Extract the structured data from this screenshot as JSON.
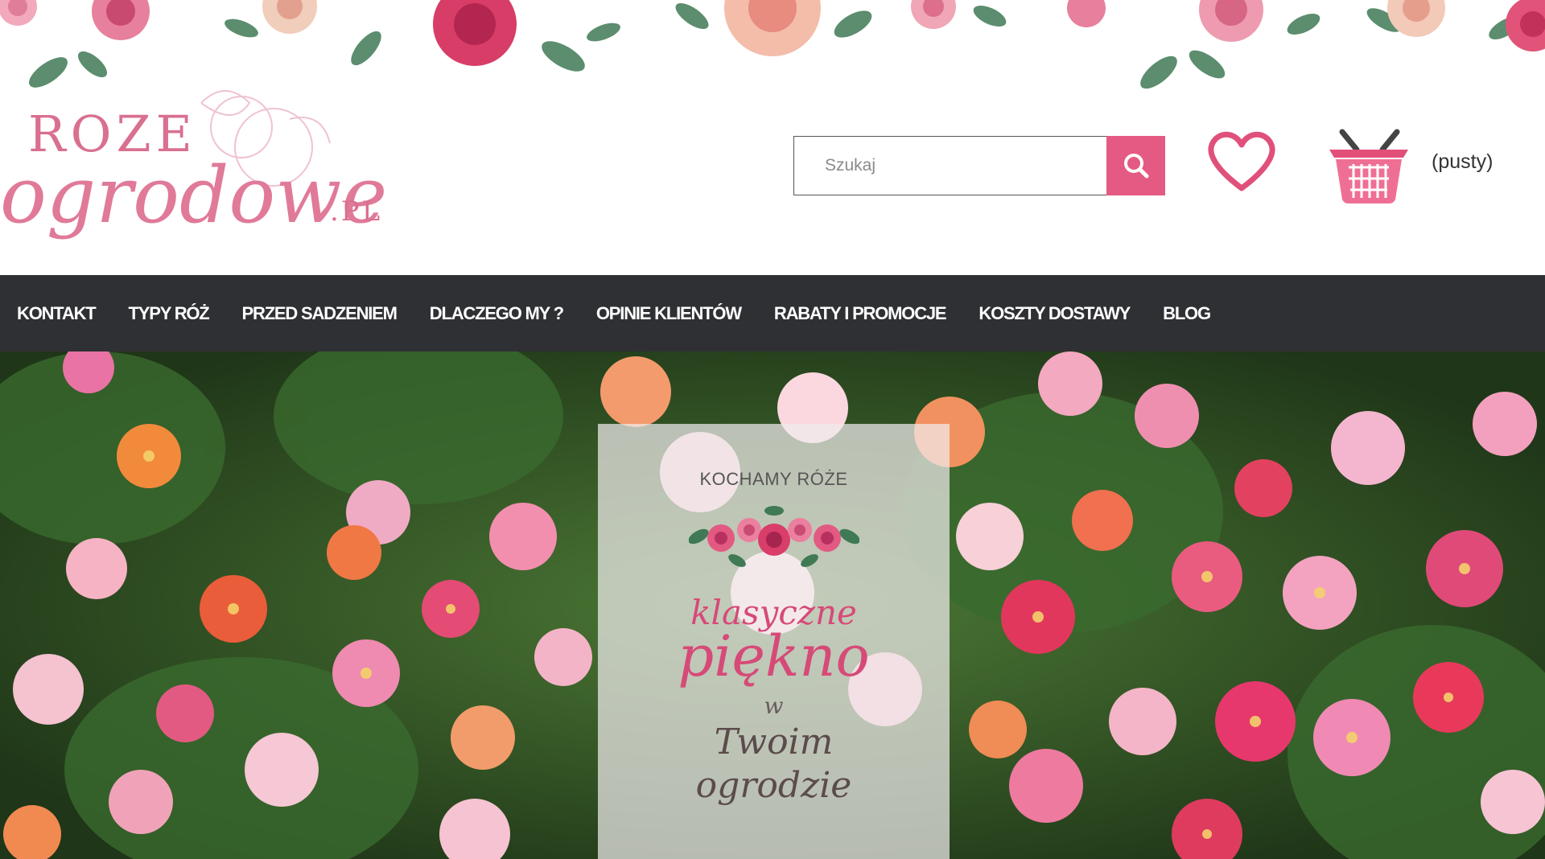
{
  "logo": {
    "text": "Rozeogrodowe.pl"
  },
  "search": {
    "placeholder": "Szukaj",
    "button_icon": "search-icon"
  },
  "wishlist": {
    "icon": "heart-icon"
  },
  "cart": {
    "icon": "basket-icon",
    "status": "(pusty)"
  },
  "nav": {
    "items": [
      {
        "label": "KONTAKT"
      },
      {
        "label": "TYPY RÓŻ"
      },
      {
        "label": "PRZED SADZENIEM"
      },
      {
        "label": "DLACZEGO MY ?"
      },
      {
        "label": "OPINIE KLIENTÓW"
      },
      {
        "label": "RABATY I PROMOCJE"
      },
      {
        "label": "KOSZTY DOSTAWY"
      },
      {
        "label": "BLOG"
      }
    ]
  },
  "hero": {
    "tagline": "KOCHAMY RÓŻE",
    "line1": "klasyczne",
    "line2": "piękno",
    "line3": "w",
    "line4": "Twoim",
    "line5": "ogrodzie"
  },
  "colors": {
    "accent": "#e45a82",
    "nav_bg": "#2f3033",
    "logo_pink": "#d97090"
  }
}
